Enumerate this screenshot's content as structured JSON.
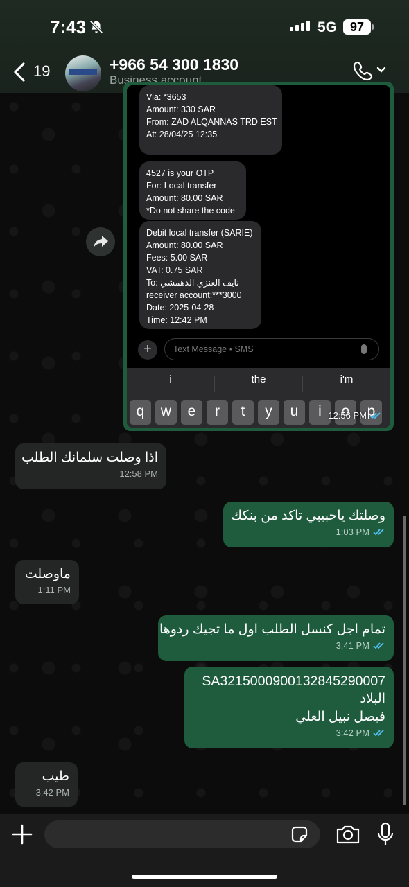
{
  "status_bar": {
    "time": "7:43",
    "network": "5G",
    "battery": "97"
  },
  "header": {
    "back_count": "19",
    "contact_name": "+966 54 300 1830",
    "contact_subtitle": "Business account"
  },
  "shared_screenshot": {
    "sms_1": {
      "lines": [
        "Via: *3653",
        "Amount: 330 SAR",
        "From: ZAD ALQANNAS TRD EST",
        "At: 28/04/25 12:35"
      ]
    },
    "sms_2": {
      "lines": [
        "4527 is your OTP",
        "For: Local transfer",
        "Amount: 80.00 SAR",
        "*Do not share the code"
      ]
    },
    "sms_3": {
      "lines": [
        "Debit local transfer (SARIE)",
        "Amount: 80.00 SAR",
        "Fees: 5.00 SAR",
        "VAT: 0.75 SAR",
        "To: نايف العنزي الدهمشي",
        "receiver account:***3000",
        "Date: 2025-04-28",
        "Time: 12:42 PM"
      ]
    },
    "input_placeholder": "Text Message • SMS",
    "suggestions": [
      "i",
      "the",
      "i'm"
    ],
    "keys": [
      "q",
      "w",
      "e",
      "r",
      "t",
      "y",
      "u",
      "i",
      "o",
      "p"
    ],
    "time": "12:56 PM"
  },
  "messages": [
    {
      "direction": "in",
      "text": "اذا وصلت سلمانك الطلب",
      "time": "12:58 PM"
    },
    {
      "direction": "out",
      "text": "وصلتك ياحبيبي تاكد من بنكك",
      "time": "1:03 PM"
    },
    {
      "direction": "in",
      "text": "ماوصلت",
      "time": "1:11 PM"
    },
    {
      "direction": "out",
      "text": "تمام اجل كنسل الطلب اول ما تجيك ردوها",
      "time": "3:41 PM"
    },
    {
      "direction": "out",
      "lines": [
        "SA3215000900132845290007",
        "البلاد",
        "فيصل نبيل العلي"
      ],
      "time": "3:42 PM"
    },
    {
      "direction": "in",
      "text": "طيب",
      "time": "3:42 PM"
    }
  ],
  "colors": {
    "outgoing_bubble": "#1f5c3e",
    "incoming_bubble": "#242626",
    "read_ticks": "#53bdeb"
  }
}
